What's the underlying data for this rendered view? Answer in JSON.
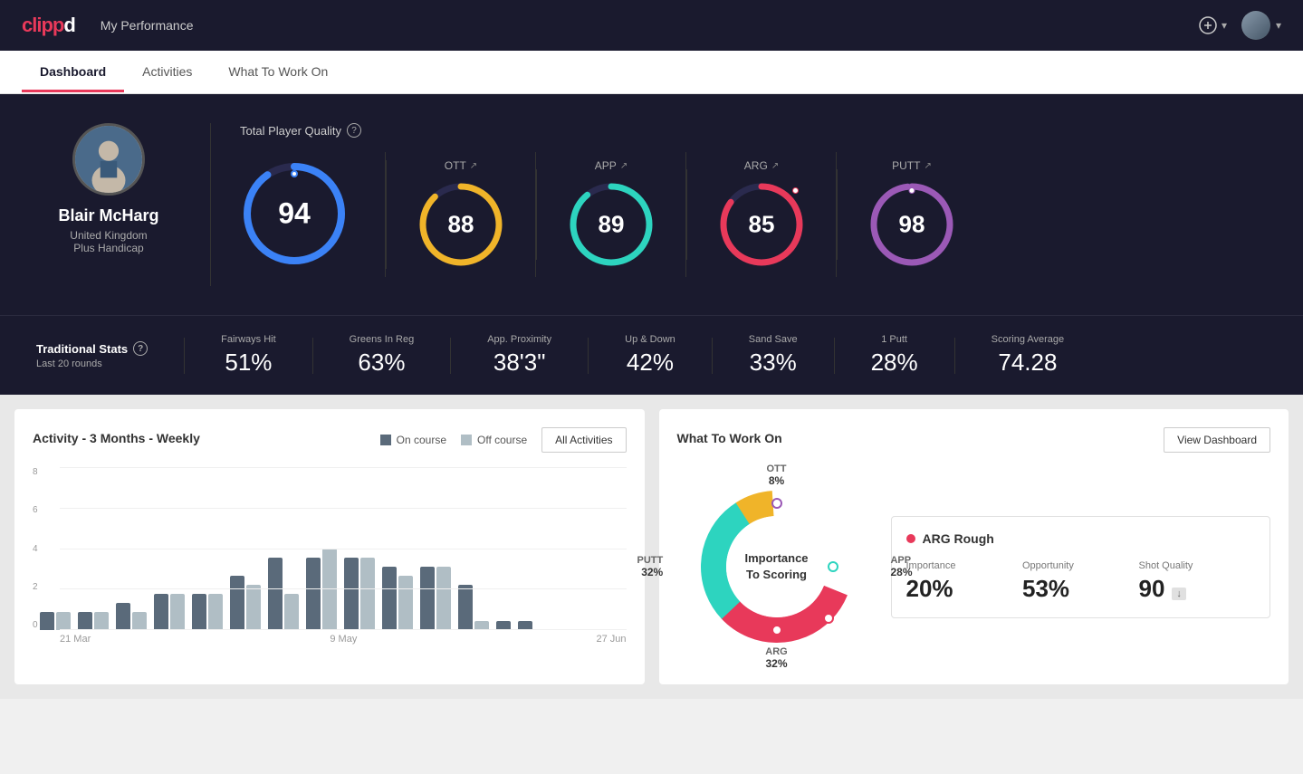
{
  "header": {
    "logo": "clippd",
    "title": "My Performance",
    "add_icon": "⊕",
    "avatar_caret": "▾"
  },
  "tabs": [
    {
      "id": "dashboard",
      "label": "Dashboard",
      "active": true
    },
    {
      "id": "activities",
      "label": "Activities",
      "active": false
    },
    {
      "id": "what-to-work-on",
      "label": "What To Work On",
      "active": false
    }
  ],
  "player": {
    "name": "Blair McHarg",
    "country": "United Kingdom",
    "handicap": "Plus Handicap"
  },
  "tpq": {
    "label": "Total Player Quality",
    "main_score": "94",
    "categories": [
      {
        "id": "ott",
        "label": "OTT",
        "score": "88",
        "color": "#f0b429",
        "track": "#333",
        "pct": 88
      },
      {
        "id": "app",
        "label": "APP",
        "score": "89",
        "color": "#2dd4bf",
        "track": "#333",
        "pct": 89
      },
      {
        "id": "arg",
        "label": "ARG",
        "score": "85",
        "color": "#e8395a",
        "track": "#333",
        "pct": 85
      },
      {
        "id": "putt",
        "label": "PUTT",
        "score": "98",
        "color": "#9b59b6",
        "track": "#333",
        "pct": 98
      }
    ],
    "main_color": "#3b82f6",
    "main_pct": 94
  },
  "trad_stats": {
    "title": "Traditional Stats",
    "subtitle": "Last 20 rounds",
    "stats": [
      {
        "label": "Fairways Hit",
        "value": "51%"
      },
      {
        "label": "Greens In Reg",
        "value": "63%"
      },
      {
        "label": "App. Proximity",
        "value": "38'3\""
      },
      {
        "label": "Up & Down",
        "value": "42%"
      },
      {
        "label": "Sand Save",
        "value": "33%"
      },
      {
        "label": "1 Putt",
        "value": "28%"
      },
      {
        "label": "Scoring Average",
        "value": "74.28"
      }
    ]
  },
  "activity_chart": {
    "title": "Activity - 3 Months - Weekly",
    "legend_on_course": "On course",
    "legend_off_course": "Off course",
    "button_label": "All Activities",
    "y_labels": [
      "8",
      "6",
      "4",
      "2",
      "0"
    ],
    "x_labels": [
      "21 Mar",
      "9 May",
      "27 Jun"
    ],
    "bars": [
      {
        "dark": 1,
        "light": 1
      },
      {
        "dark": 1,
        "light": 1
      },
      {
        "dark": 1.5,
        "light": 1
      },
      {
        "dark": 2,
        "light": 2
      },
      {
        "dark": 2,
        "light": 2
      },
      {
        "dark": 3,
        "light": 2.5
      },
      {
        "dark": 4,
        "light": 2
      },
      {
        "dark": 4,
        "light": 4.5
      },
      {
        "dark": 4,
        "light": 4
      },
      {
        "dark": 3.5,
        "light": 3
      },
      {
        "dark": 3.5,
        "light": 3.5
      },
      {
        "dark": 2.5,
        "light": 0.5
      },
      {
        "dark": 0.5,
        "light": 0
      },
      {
        "dark": 0.5,
        "light": 0
      }
    ]
  },
  "what_to_work_on": {
    "title": "What To Work On",
    "view_button": "View Dashboard",
    "donut_center": "Importance\nTo Scoring",
    "segments": [
      {
        "label": "OTT",
        "pct": "8%",
        "color": "#f0b429"
      },
      {
        "label": "APP",
        "pct": "28%",
        "color": "#2dd4bf"
      },
      {
        "label": "ARG",
        "pct": "32%",
        "color": "#e8395a"
      },
      {
        "label": "PUTT",
        "pct": "32%",
        "color": "#9b59b6"
      }
    ],
    "card": {
      "title": "ARG Rough",
      "metrics": [
        {
          "label": "Importance",
          "value": "20%"
        },
        {
          "label": "Opportunity",
          "value": "53%"
        },
        {
          "label": "Shot Quality",
          "value": "90",
          "badge": "↓"
        }
      ]
    }
  }
}
